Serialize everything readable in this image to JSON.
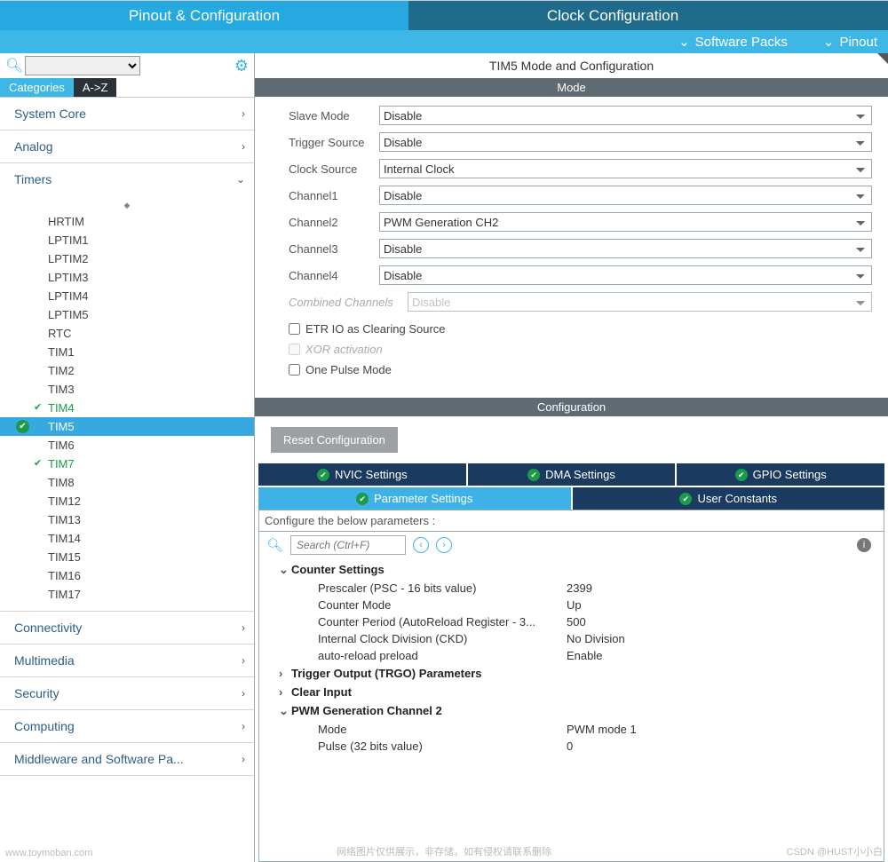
{
  "tabs": {
    "pinout": "Pinout & Configuration",
    "clock": "Clock Configuration"
  },
  "subbar": {
    "packs": "Software Packs",
    "pinout": "Pinout"
  },
  "sidebar": {
    "cat_tab": "Categories",
    "az_tab": "A->Z",
    "groups": [
      {
        "name": "System Core",
        "exp": "›"
      },
      {
        "name": "Analog",
        "exp": "›"
      },
      {
        "name": "Timers",
        "exp": "⌄"
      },
      {
        "name": "Connectivity",
        "exp": "›"
      },
      {
        "name": "Multimedia",
        "exp": "›"
      },
      {
        "name": "Security",
        "exp": "›"
      },
      {
        "name": "Computing",
        "exp": "›"
      },
      {
        "name": "Middleware and Software Pa...",
        "exp": "›"
      }
    ],
    "timers": [
      "HRTIM",
      "LPTIM1",
      "LPTIM2",
      "LPTIM3",
      "LPTIM4",
      "LPTIM5",
      "RTC",
      "TIM1",
      "TIM2",
      "TIM3",
      "TIM4",
      "TIM5",
      "TIM6",
      "TIM7",
      "TIM8",
      "TIM12",
      "TIM13",
      "TIM14",
      "TIM15",
      "TIM16",
      "TIM17"
    ]
  },
  "panel": {
    "title": "TIM5 Mode and Configuration",
    "mode_label": "Mode",
    "fields": {
      "slave": {
        "label": "Slave Mode",
        "value": "Disable"
      },
      "trigger": {
        "label": "Trigger Source",
        "value": "Disable"
      },
      "clock": {
        "label": "Clock Source",
        "value": "Internal Clock"
      },
      "ch1": {
        "label": "Channel1",
        "value": "Disable"
      },
      "ch2": {
        "label": "Channel2",
        "value": "PWM Generation CH2"
      },
      "ch3": {
        "label": "Channel3",
        "value": "Disable"
      },
      "ch4": {
        "label": "Channel4",
        "value": "Disable"
      },
      "combined": {
        "label": "Combined Channels",
        "value": "Disable"
      }
    },
    "checks": {
      "etr": "ETR IO as Clearing Source",
      "xor": "XOR activation",
      "one_pulse": "One Pulse Mode"
    }
  },
  "config": {
    "title": "Configuration",
    "reset": "Reset Configuration",
    "tabs1": [
      "NVIC Settings",
      "DMA Settings",
      "GPIO Settings"
    ],
    "tabs2": [
      "Parameter Settings",
      "User Constants"
    ],
    "header": "Configure the below parameters :",
    "search_ph": "Search (Ctrl+F)",
    "groups": {
      "counter": "Counter Settings",
      "trgo": "Trigger Output (TRGO) Parameters",
      "clear": "Clear Input",
      "pwm2": "PWM Generation Channel 2"
    },
    "params": {
      "prescaler": {
        "label": "Prescaler (PSC - 16 bits value)",
        "value": "2399"
      },
      "cmode": {
        "label": "Counter Mode",
        "value": "Up"
      },
      "period": {
        "label": "Counter Period (AutoReload Register - 3...",
        "value": "500"
      },
      "ckd": {
        "label": "Internal Clock Division (CKD)",
        "value": "No Division"
      },
      "preload": {
        "label": "auto-reload preload",
        "value": "Enable"
      },
      "mode": {
        "label": "Mode",
        "value": "PWM mode 1"
      },
      "pulse": {
        "label": "Pulse (32 bits value)",
        "value": "0"
      }
    }
  },
  "footer": {
    "left": "www.toymoban.com",
    "center": "网络图片仅供展示，非存储，如有侵权请联系删除",
    "right": "CSDN @HUST小小白"
  }
}
